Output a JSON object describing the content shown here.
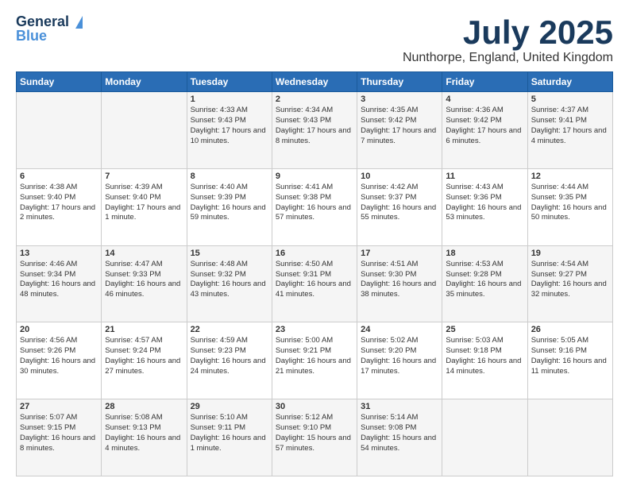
{
  "header": {
    "logo_line1": "General",
    "logo_line2": "Blue",
    "month": "July 2025",
    "location": "Nunthorpe, England, United Kingdom"
  },
  "days_of_week": [
    "Sunday",
    "Monday",
    "Tuesday",
    "Wednesday",
    "Thursday",
    "Friday",
    "Saturday"
  ],
  "weeks": [
    [
      {
        "day": "",
        "sunrise": "",
        "sunset": "",
        "daylight": ""
      },
      {
        "day": "",
        "sunrise": "",
        "sunset": "",
        "daylight": ""
      },
      {
        "day": "1",
        "sunrise": "Sunrise: 4:33 AM",
        "sunset": "Sunset: 9:43 PM",
        "daylight": "Daylight: 17 hours and 10 minutes."
      },
      {
        "day": "2",
        "sunrise": "Sunrise: 4:34 AM",
        "sunset": "Sunset: 9:43 PM",
        "daylight": "Daylight: 17 hours and 8 minutes."
      },
      {
        "day": "3",
        "sunrise": "Sunrise: 4:35 AM",
        "sunset": "Sunset: 9:42 PM",
        "daylight": "Daylight: 17 hours and 7 minutes."
      },
      {
        "day": "4",
        "sunrise": "Sunrise: 4:36 AM",
        "sunset": "Sunset: 9:42 PM",
        "daylight": "Daylight: 17 hours and 6 minutes."
      },
      {
        "day": "5",
        "sunrise": "Sunrise: 4:37 AM",
        "sunset": "Sunset: 9:41 PM",
        "daylight": "Daylight: 17 hours and 4 minutes."
      }
    ],
    [
      {
        "day": "6",
        "sunrise": "Sunrise: 4:38 AM",
        "sunset": "Sunset: 9:40 PM",
        "daylight": "Daylight: 17 hours and 2 minutes."
      },
      {
        "day": "7",
        "sunrise": "Sunrise: 4:39 AM",
        "sunset": "Sunset: 9:40 PM",
        "daylight": "Daylight: 17 hours and 1 minute."
      },
      {
        "day": "8",
        "sunrise": "Sunrise: 4:40 AM",
        "sunset": "Sunset: 9:39 PM",
        "daylight": "Daylight: 16 hours and 59 minutes."
      },
      {
        "day": "9",
        "sunrise": "Sunrise: 4:41 AM",
        "sunset": "Sunset: 9:38 PM",
        "daylight": "Daylight: 16 hours and 57 minutes."
      },
      {
        "day": "10",
        "sunrise": "Sunrise: 4:42 AM",
        "sunset": "Sunset: 9:37 PM",
        "daylight": "Daylight: 16 hours and 55 minutes."
      },
      {
        "day": "11",
        "sunrise": "Sunrise: 4:43 AM",
        "sunset": "Sunset: 9:36 PM",
        "daylight": "Daylight: 16 hours and 53 minutes."
      },
      {
        "day": "12",
        "sunrise": "Sunrise: 4:44 AM",
        "sunset": "Sunset: 9:35 PM",
        "daylight": "Daylight: 16 hours and 50 minutes."
      }
    ],
    [
      {
        "day": "13",
        "sunrise": "Sunrise: 4:46 AM",
        "sunset": "Sunset: 9:34 PM",
        "daylight": "Daylight: 16 hours and 48 minutes."
      },
      {
        "day": "14",
        "sunrise": "Sunrise: 4:47 AM",
        "sunset": "Sunset: 9:33 PM",
        "daylight": "Daylight: 16 hours and 46 minutes."
      },
      {
        "day": "15",
        "sunrise": "Sunrise: 4:48 AM",
        "sunset": "Sunset: 9:32 PM",
        "daylight": "Daylight: 16 hours and 43 minutes."
      },
      {
        "day": "16",
        "sunrise": "Sunrise: 4:50 AM",
        "sunset": "Sunset: 9:31 PM",
        "daylight": "Daylight: 16 hours and 41 minutes."
      },
      {
        "day": "17",
        "sunrise": "Sunrise: 4:51 AM",
        "sunset": "Sunset: 9:30 PM",
        "daylight": "Daylight: 16 hours and 38 minutes."
      },
      {
        "day": "18",
        "sunrise": "Sunrise: 4:53 AM",
        "sunset": "Sunset: 9:28 PM",
        "daylight": "Daylight: 16 hours and 35 minutes."
      },
      {
        "day": "19",
        "sunrise": "Sunrise: 4:54 AM",
        "sunset": "Sunset: 9:27 PM",
        "daylight": "Daylight: 16 hours and 32 minutes."
      }
    ],
    [
      {
        "day": "20",
        "sunrise": "Sunrise: 4:56 AM",
        "sunset": "Sunset: 9:26 PM",
        "daylight": "Daylight: 16 hours and 30 minutes."
      },
      {
        "day": "21",
        "sunrise": "Sunrise: 4:57 AM",
        "sunset": "Sunset: 9:24 PM",
        "daylight": "Daylight: 16 hours and 27 minutes."
      },
      {
        "day": "22",
        "sunrise": "Sunrise: 4:59 AM",
        "sunset": "Sunset: 9:23 PM",
        "daylight": "Daylight: 16 hours and 24 minutes."
      },
      {
        "day": "23",
        "sunrise": "Sunrise: 5:00 AM",
        "sunset": "Sunset: 9:21 PM",
        "daylight": "Daylight: 16 hours and 21 minutes."
      },
      {
        "day": "24",
        "sunrise": "Sunrise: 5:02 AM",
        "sunset": "Sunset: 9:20 PM",
        "daylight": "Daylight: 16 hours and 17 minutes."
      },
      {
        "day": "25",
        "sunrise": "Sunrise: 5:03 AM",
        "sunset": "Sunset: 9:18 PM",
        "daylight": "Daylight: 16 hours and 14 minutes."
      },
      {
        "day": "26",
        "sunrise": "Sunrise: 5:05 AM",
        "sunset": "Sunset: 9:16 PM",
        "daylight": "Daylight: 16 hours and 11 minutes."
      }
    ],
    [
      {
        "day": "27",
        "sunrise": "Sunrise: 5:07 AM",
        "sunset": "Sunset: 9:15 PM",
        "daylight": "Daylight: 16 hours and 8 minutes."
      },
      {
        "day": "28",
        "sunrise": "Sunrise: 5:08 AM",
        "sunset": "Sunset: 9:13 PM",
        "daylight": "Daylight: 16 hours and 4 minutes."
      },
      {
        "day": "29",
        "sunrise": "Sunrise: 5:10 AM",
        "sunset": "Sunset: 9:11 PM",
        "daylight": "Daylight: 16 hours and 1 minute."
      },
      {
        "day": "30",
        "sunrise": "Sunrise: 5:12 AM",
        "sunset": "Sunset: 9:10 PM",
        "daylight": "Daylight: 15 hours and 57 minutes."
      },
      {
        "day": "31",
        "sunrise": "Sunrise: 5:14 AM",
        "sunset": "Sunset: 9:08 PM",
        "daylight": "Daylight: 15 hours and 54 minutes."
      },
      {
        "day": "",
        "sunrise": "",
        "sunset": "",
        "daylight": ""
      },
      {
        "day": "",
        "sunrise": "",
        "sunset": "",
        "daylight": ""
      }
    ]
  ]
}
